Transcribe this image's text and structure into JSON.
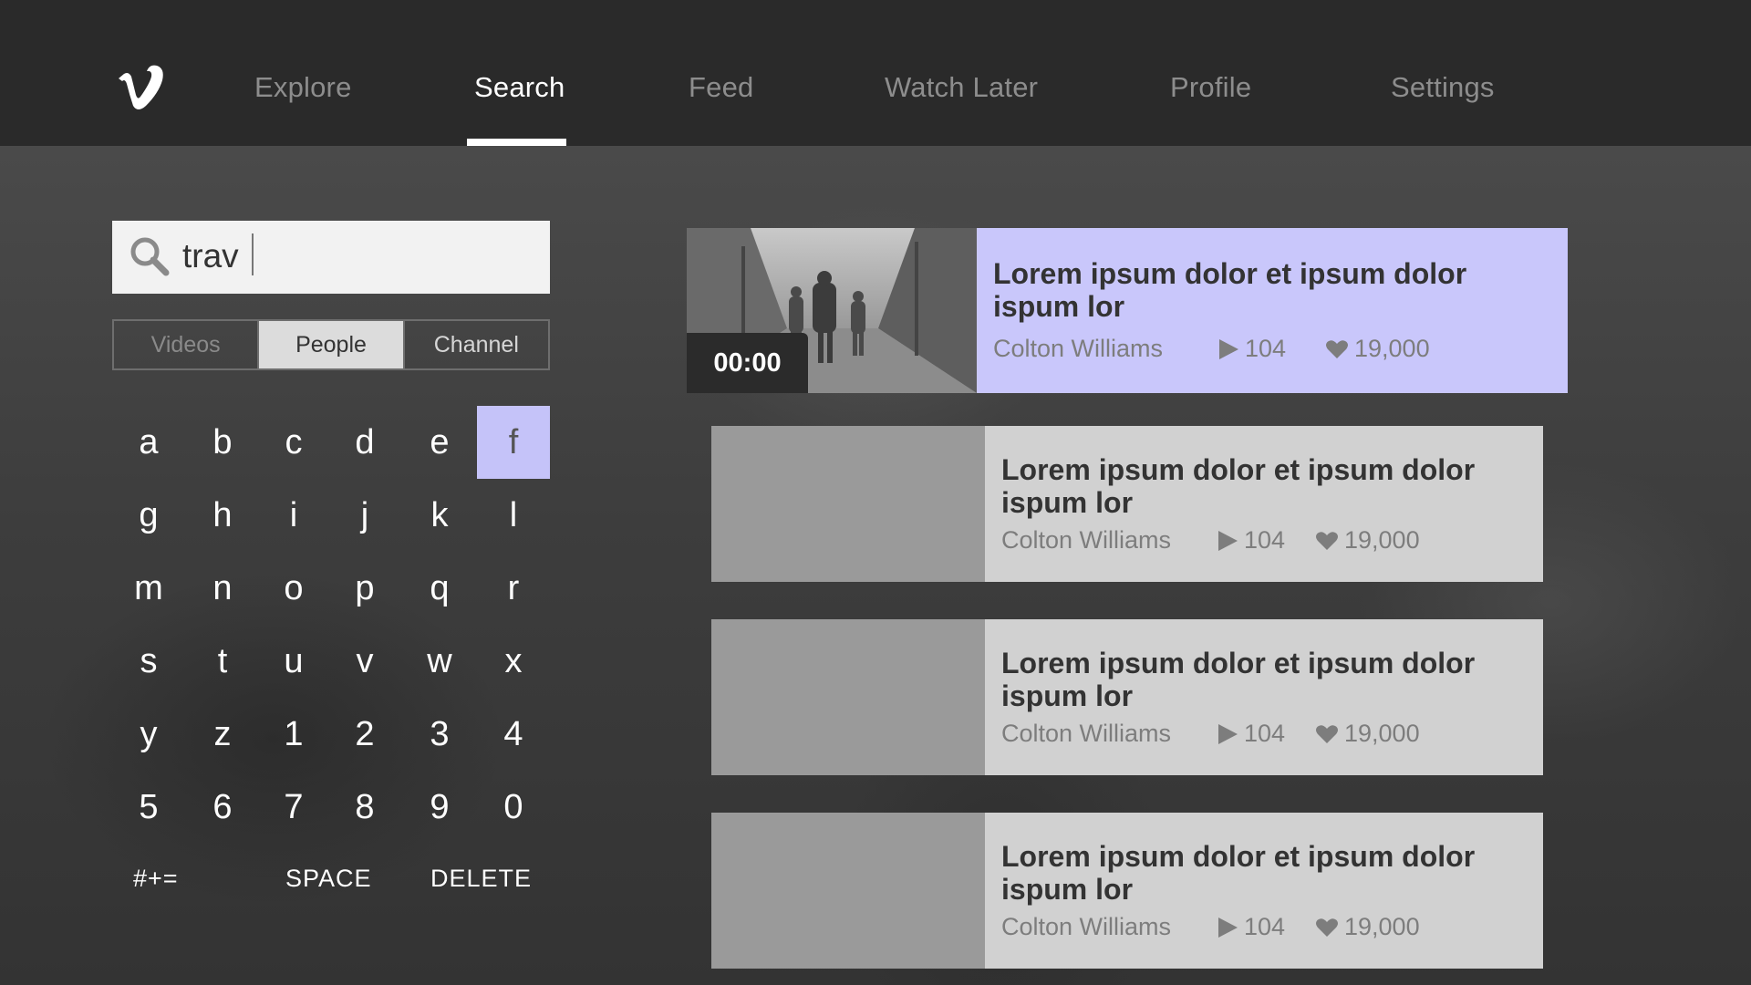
{
  "nav": {
    "items": [
      {
        "label": "Explore"
      },
      {
        "label": "Search"
      },
      {
        "label": "Feed"
      },
      {
        "label": "Watch Later"
      },
      {
        "label": "Profile"
      },
      {
        "label": "Settings"
      }
    ],
    "active": "Search"
  },
  "search": {
    "query": "trav"
  },
  "filters": {
    "options": [
      "Videos",
      "People",
      "Channel"
    ],
    "selected": "People"
  },
  "keyboard": {
    "keys": [
      "a",
      "b",
      "c",
      "d",
      "e",
      "f",
      "g",
      "h",
      "i",
      "j",
      "k",
      "l",
      "m",
      "n",
      "o",
      "p",
      "q",
      "r",
      "s",
      "t",
      "u",
      "v",
      "w",
      "x",
      "y",
      "z",
      "1",
      "2",
      "3",
      "4",
      "5",
      "6",
      "7",
      "8",
      "9",
      "0"
    ],
    "focused_key": "f",
    "symbols_label": "#+=",
    "space_label": "SPACE",
    "delete_label": "DELETE"
  },
  "results": [
    {
      "title": "Lorem ipsum dolor et ipsum dolor ispum lor",
      "author": "Colton Williams",
      "plays": "104",
      "likes": "19,000",
      "duration": "00:00"
    },
    {
      "title": "Lorem ipsum dolor et ipsum dolor ispum lor",
      "author": "Colton Williams",
      "plays": "104",
      "likes": "19,000"
    },
    {
      "title": "Lorem ipsum dolor et ipsum dolor ispum lor",
      "author": "Colton Williams",
      "plays": "104",
      "likes": "19,000"
    },
    {
      "title": "Lorem ipsum dolor et ipsum dolor ispum lor",
      "author": "Colton Williams",
      "plays": "104",
      "likes": "19,000"
    }
  ],
  "colors": {
    "navbar": "#2a2a2a",
    "focus_accent": "#c5c3f9",
    "card_bg": "#d1d1d1"
  }
}
